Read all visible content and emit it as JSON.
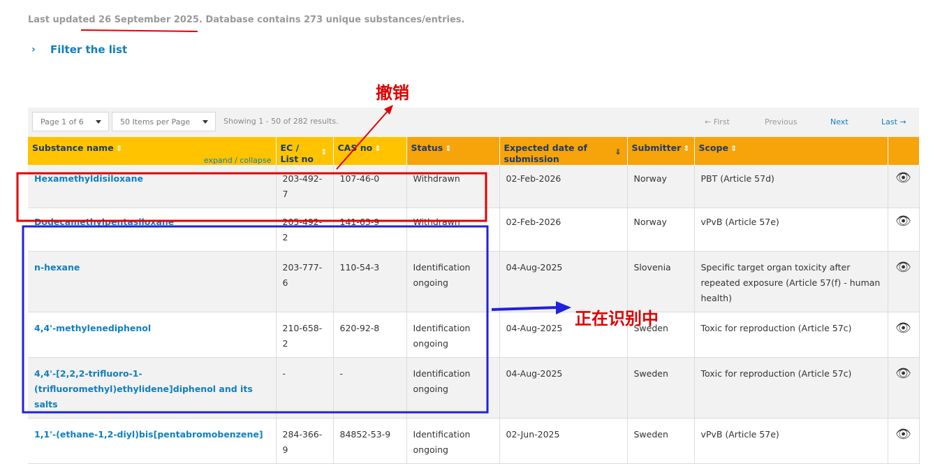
{
  "header": {
    "updated_prefix": "Last updated ",
    "updated_date": "26 September 2025",
    "updated_suffix": ". Database contains 273 unique substances/entries.",
    "filter_label": "Filter the list",
    "filter_icon": "chevron-right-icon"
  },
  "toolbar": {
    "page_select": "Page 1 of 6",
    "items_select": "50 Items per Page",
    "showing": "Showing 1 - 50 of 282 results.",
    "first": "← First",
    "previous": "Previous",
    "next": "Next",
    "last": "Last →"
  },
  "table": {
    "columns": {
      "substance": "Substance name",
      "expand": "expand / collapse",
      "ec": "EC /",
      "ec2": "List no",
      "cas": "CAS no",
      "status": "Status",
      "expected": "Expected date of submission",
      "submitter": "Submitter",
      "scope": "Scope"
    },
    "rows": [
      {
        "name": "Hexamethyldisiloxane",
        "ec": "203-492-7",
        "cas": "107-46-0",
        "status": "Withdrawn",
        "date": "02-Feb-2026",
        "submitter": "Norway",
        "scope": "PBT (Article 57d)"
      },
      {
        "name": "Dodecamethylpentasiloxane",
        "ec": "205-492-2",
        "cas": "141-63-9",
        "status": "Withdrawn",
        "date": "02-Feb-2026",
        "submitter": "Norway",
        "scope": "vPvB (Article 57e)"
      },
      {
        "name": "n-hexane",
        "ec": "203-777-6",
        "cas": "110-54-3",
        "status": "Identification ongoing",
        "date": "04-Aug-2025",
        "submitter": "Slovenia",
        "scope": "Specific target organ toxicity after repeated exposure (Article 57(f) - human health)"
      },
      {
        "name": "4,4'-methylenediphenol",
        "ec": "210-658-2",
        "cas": "620-92-8",
        "status": "Identification ongoing",
        "date": "04-Aug-2025",
        "submitter": "Sweden",
        "scope": "Toxic for reproduction (Article 57c)"
      },
      {
        "name": "4,4'-[2,2,2-trifluoro-1-(trifluoromethyl)ethylidene]diphenol and its salts",
        "ec": "-",
        "cas": "-",
        "status": "Identification ongoing",
        "date": "04-Aug-2025",
        "submitter": "Sweden",
        "scope": "Toxic for reproduction (Article 57c)"
      },
      {
        "name": "1,1'-(ethane-1,2-diyl)bis[pentabromobenzene]",
        "ec": "284-366-9",
        "cas": "84852-53-9",
        "status": "Identification ongoing",
        "date": "02-Jun-2025",
        "submitter": "Sweden",
        "scope": "vPvB (Article 57e)"
      }
    ]
  },
  "annotations": {
    "withdrawn_note": "撤销",
    "ongoing_note": "正在识别中",
    "red": "#e00000",
    "blue": "#2020e0"
  },
  "colors": {
    "header_orange": "#f7a30a",
    "header_yellow": "#ffc300",
    "link_blue": "#0f7fbf"
  }
}
